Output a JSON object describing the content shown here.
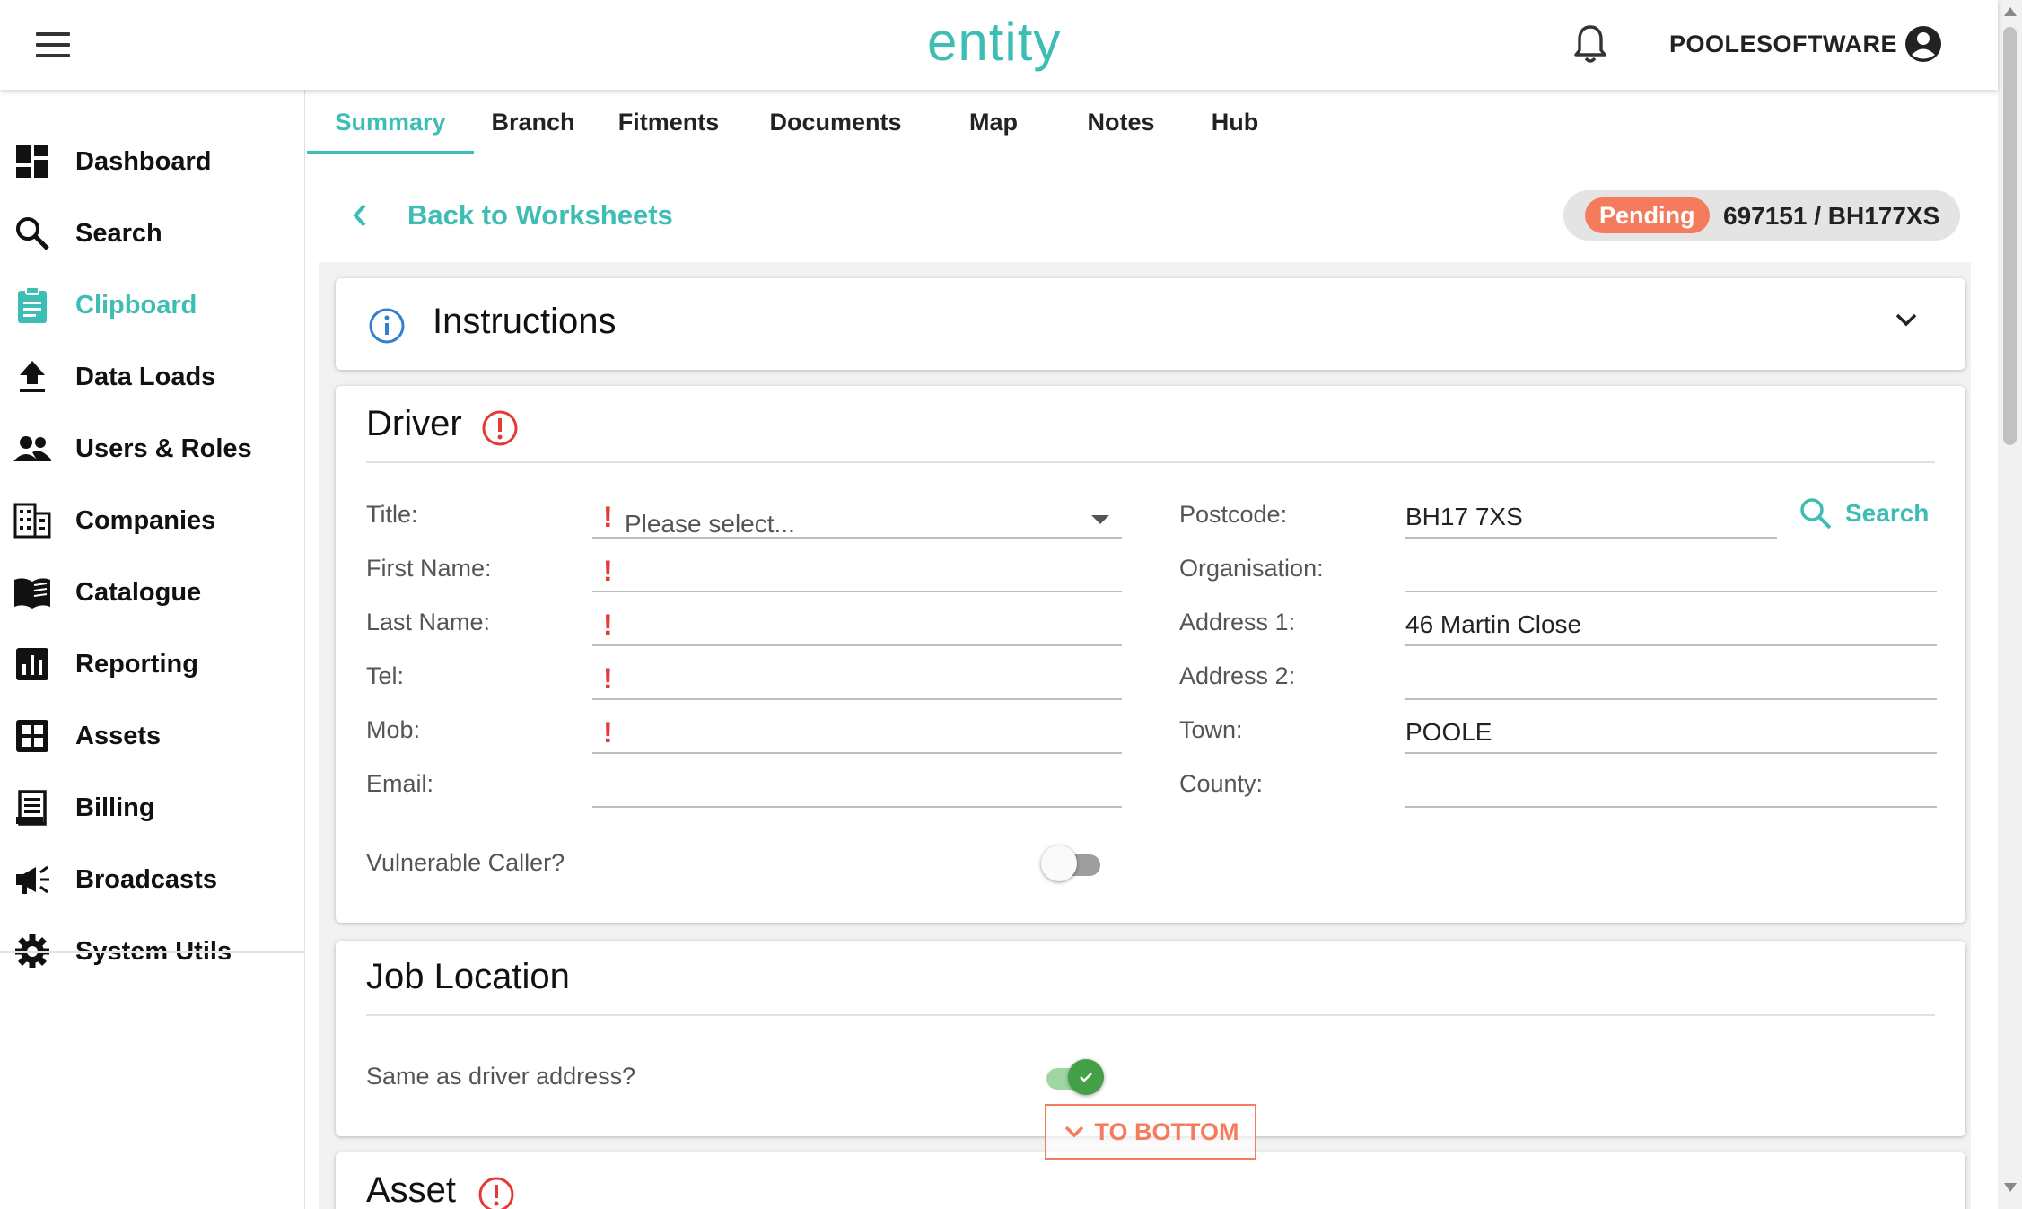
{
  "app": {
    "logo": "entity",
    "username": "POOLESOFTWARE"
  },
  "sidebar": {
    "items": [
      {
        "label": "Dashboard",
        "icon": "dashboard-icon"
      },
      {
        "label": "Search",
        "icon": "search-icon"
      },
      {
        "label": "Clipboard",
        "icon": "clipboard-icon",
        "active": true
      },
      {
        "label": "Data Loads",
        "icon": "upload-icon"
      },
      {
        "label": "Users & Roles",
        "icon": "people-icon"
      },
      {
        "label": "Companies",
        "icon": "building-icon"
      },
      {
        "label": "Catalogue",
        "icon": "book-icon"
      },
      {
        "label": "Reporting",
        "icon": "bar-chart-icon"
      },
      {
        "label": "Assets",
        "icon": "grid-icon"
      },
      {
        "label": "Billing",
        "icon": "receipt-icon"
      },
      {
        "label": "Broadcasts",
        "icon": "megaphone-icon"
      },
      {
        "label": "System Utils",
        "icon": "gear-icon"
      }
    ]
  },
  "tabs": [
    "Summary",
    "Branch",
    "Fitments",
    "Documents",
    "Map",
    "Notes",
    "Hub"
  ],
  "back_label": "Back to Worksheets",
  "status": {
    "label": "Pending",
    "reference": "697151 / BH177XS",
    "color": "#f47c5d"
  },
  "instructions": {
    "title": "Instructions"
  },
  "driver": {
    "title": "Driver",
    "title_label": "Title:",
    "title_placeholder": "Please select...",
    "first_name_label": "First Name:",
    "last_name_label": "Last Name:",
    "tel_label": "Tel:",
    "mob_label": "Mob:",
    "email_label": "Email:",
    "postcode_label": "Postcode:",
    "postcode": "BH17 7XS",
    "search_label": "Search",
    "organisation_label": "Organisation:",
    "address1_label": "Address 1:",
    "address1": "46 Martin Close",
    "address2_label": "Address 2:",
    "town_label": "Town:",
    "town": "POOLE",
    "county_label": "County:",
    "vulnerable_label": "Vulnerable Caller?",
    "vulnerable": false
  },
  "job_location": {
    "title": "Job Location",
    "same_label": "Same as driver address?",
    "same": true
  },
  "asset": {
    "title": "Asset"
  },
  "to_bottom_label": "TO BOTTOM",
  "colors": {
    "accent": "#3dbdb3",
    "warning": "#e53935",
    "pending": "#f47c5d",
    "toggle_on": "#43a047"
  }
}
